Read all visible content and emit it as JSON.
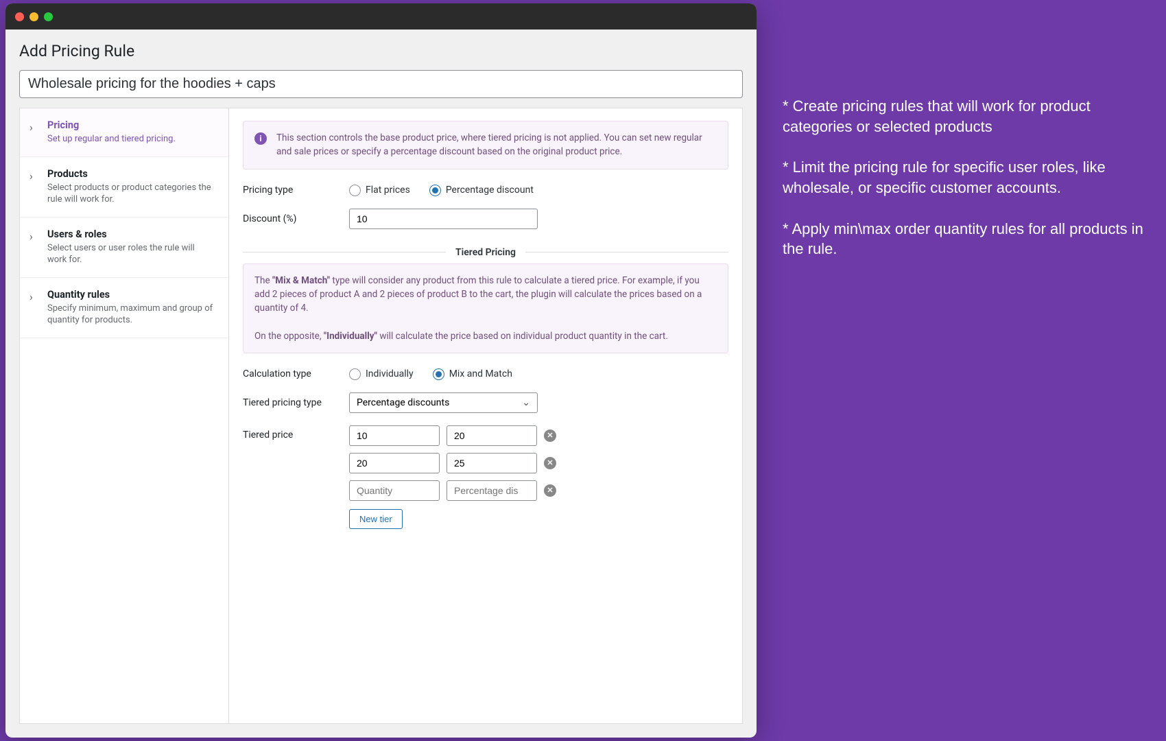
{
  "page_title": "Add Pricing Rule",
  "rule_name": "Wholesale pricing for the hoodies + caps",
  "sidebar": {
    "items": [
      {
        "title": "Pricing",
        "desc": "Set up regular and tiered pricing.",
        "active": true
      },
      {
        "title": "Products",
        "desc": "Select products or product categories the rule will work for.",
        "active": false
      },
      {
        "title": "Users & roles",
        "desc": "Select users or user roles the rule will work for.",
        "active": false
      },
      {
        "title": "Quantity rules",
        "desc": "Specify minimum, maximum and group of quantity for products.",
        "active": false
      }
    ]
  },
  "notice1": "This section controls the base product price, where tiered pricing is not applied. You can set new regular and sale prices or specify a percentage discount based on the original product price.",
  "pricing": {
    "type_label": "Pricing type",
    "flat_label": "Flat prices",
    "percent_label": "Percentage discount",
    "discount_label": "Discount (%)",
    "discount_value": "10"
  },
  "tiered_header": "Tiered Pricing",
  "notice2_pre": "The ",
  "notice2_bold1": "\"Mix & Match\"",
  "notice2_mid": " type will consider any product from this rule to calculate a tiered price. For example, if you add 2 pieces of product A and 2 pieces of product B to the cart, the plugin will calculate the prices based on a quantity of 4.",
  "notice2_line2_pre": "On the opposite, ",
  "notice2_bold2": "\"Individually\"",
  "notice2_line2_post": " will calculate the price based on individual product quantity in the cart.",
  "calc": {
    "label": "Calculation type",
    "ind_label": "Individually",
    "mix_label": "Mix and Match"
  },
  "tiered_type": {
    "label": "Tiered pricing type",
    "selected": "Percentage discounts"
  },
  "tiered_price_label": "Tiered price",
  "tiers": [
    {
      "qty": "10",
      "disc": "20"
    },
    {
      "qty": "20",
      "disc": "25"
    }
  ],
  "tier_placeholder_qty": "Quantity",
  "tier_placeholder_disc": "Percentage dis",
  "new_tier_label": "New tier",
  "annotations": {
    "a1": "* Create pricing rules that will work for product categories or selected products",
    "a2": "* Limit the pricing rule for specific user roles, like wholesale, or specific customer accounts.",
    "a3": "* Apply min\\max order quantity rules for all products in the rule."
  }
}
